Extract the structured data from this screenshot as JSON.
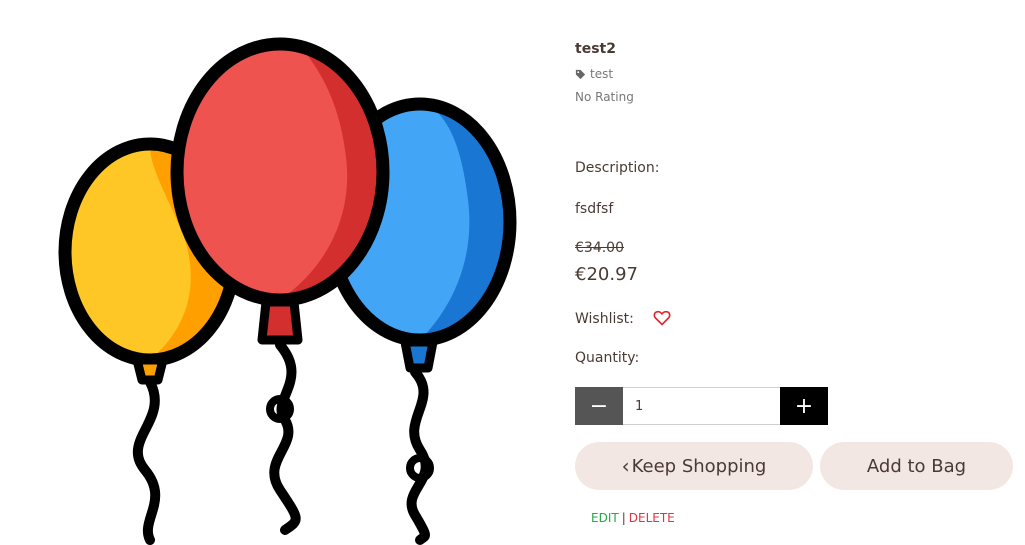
{
  "product": {
    "name": "test2",
    "tag": "test",
    "rating": "No Rating",
    "description_label": "Description:",
    "description": "fsdfsf",
    "original_price": "€34.00",
    "price": "€20.97",
    "wishlist_label": "Wishlist:",
    "quantity_label": "Quantity:",
    "quantity": "1"
  },
  "buttons": {
    "decrement": "−",
    "increment": "+",
    "keep_shopping": "Keep Shopping",
    "add_to_bag": "Add to Bag"
  },
  "admin": {
    "edit": "EDIT",
    "separator": "|",
    "delete": "DELETE"
  },
  "icons": {
    "tag": "tag-icon",
    "wishlist": "heart-outline-icon",
    "back": "chevron-left-icon"
  },
  "colors": {
    "minus_button": "#555555",
    "plus_button": "#000000",
    "pill_button": "#f3e7e4",
    "heart": "#e0282f",
    "edit": "#28a745",
    "delete": "#dc3545"
  }
}
